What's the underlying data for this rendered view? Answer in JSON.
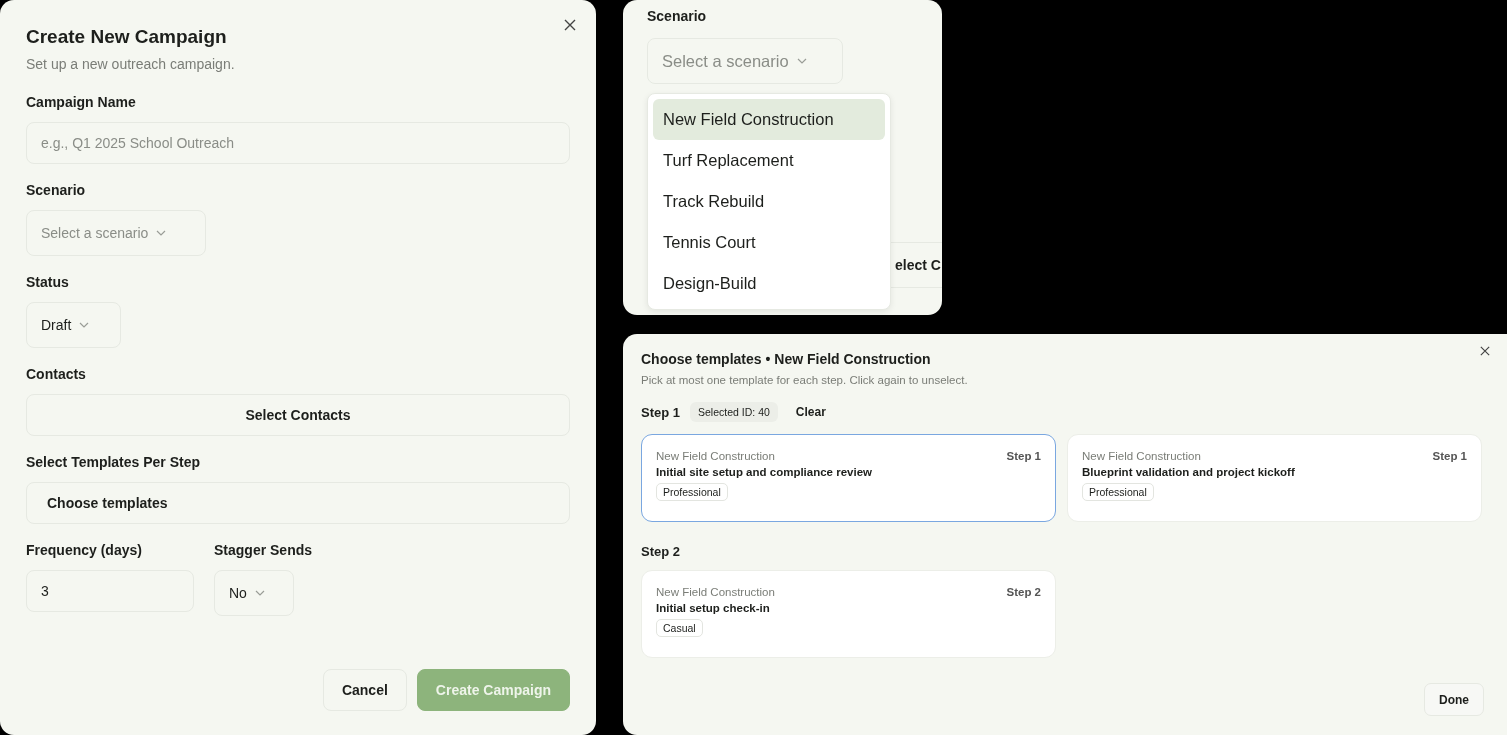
{
  "campaign_dialog": {
    "title": "Create New Campaign",
    "subtitle": "Set up a new outreach campaign.",
    "campaign_name": {
      "label": "Campaign Name",
      "placeholder": "e.g., Q1 2025 School Outreach"
    },
    "scenario": {
      "label": "Scenario",
      "placeholder": "Select a scenario"
    },
    "status": {
      "label": "Status",
      "value": "Draft"
    },
    "contacts": {
      "label": "Contacts",
      "button": "Select Contacts"
    },
    "templates": {
      "label": "Select Templates Per Step",
      "button": "Choose templates"
    },
    "frequency": {
      "label": "Frequency (days)",
      "value": "3"
    },
    "stagger": {
      "label": "Stagger Sends",
      "value": "No"
    },
    "buttons": [
      {
        "label": "Cancel",
        "kind": "secondary",
        "disabled": false
      },
      {
        "label": "Create Campaign",
        "kind": "primary",
        "disabled": true
      }
    ]
  },
  "scenario_dropdown": {
    "label": "Scenario",
    "placeholder": "Select a scenario",
    "button_behind": "elect C",
    "options": [
      {
        "label": "New Field Construction",
        "selected": true
      },
      {
        "label": "Turf Replacement",
        "selected": false
      },
      {
        "label": "Track Rebuild",
        "selected": false
      },
      {
        "label": "Tennis Court",
        "selected": false
      },
      {
        "label": "Design-Build",
        "selected": false
      }
    ]
  },
  "template_picker": {
    "title": "Choose templates • New Field Construction",
    "subtitle": "Pick at most one template for each step. Click again to unselect.",
    "steps": [
      {
        "label": "Step 1",
        "selected_badge": "Selected ID: 40",
        "clear": "Clear",
        "templates": [
          {
            "scenario": "New Field Construction",
            "step": "Step 1",
            "name": "Initial site setup and compliance review",
            "tone": "Professional",
            "selected": true
          },
          {
            "scenario": "New Field Construction",
            "step": "Step 1",
            "name": "Blueprint validation and project kickoff",
            "tone": "Professional",
            "selected": false
          }
        ]
      },
      {
        "label": "Step 2",
        "templates": [
          {
            "scenario": "New Field Construction",
            "step": "Step 2",
            "name": "Initial setup check-in",
            "tone": "Casual",
            "selected": false
          }
        ]
      }
    ],
    "done": "Done"
  }
}
